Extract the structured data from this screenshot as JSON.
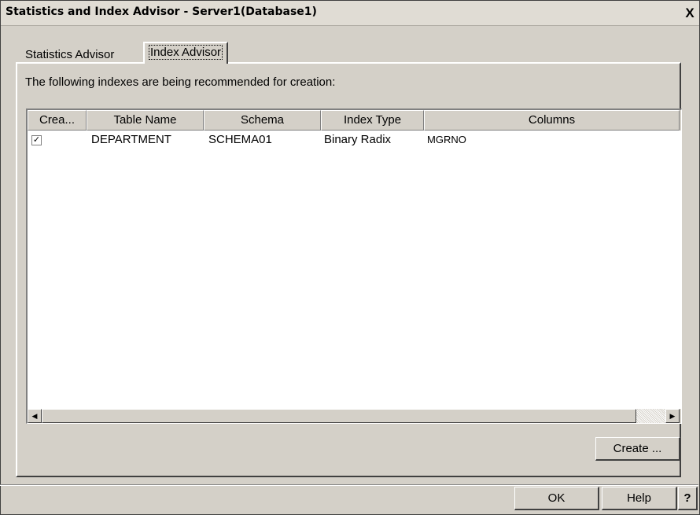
{
  "window": {
    "title": "Statistics and Index Advisor - Server1(Database1)",
    "close_label": "X"
  },
  "tabs": [
    {
      "label": "Statistics Advisor",
      "active": false
    },
    {
      "label": "Index Advisor",
      "active": true
    }
  ],
  "instruction": "The following indexes are being recommended for creation:",
  "table": {
    "columns": [
      "Crea...",
      "Table Name",
      "Schema",
      "Index Type",
      "Columns"
    ],
    "rows": [
      {
        "checked": true,
        "table_name": "DEPARTMENT",
        "schema": "SCHEMA01",
        "index_type": "Binary Radix",
        "columns": "MGRNO"
      }
    ]
  },
  "buttons": {
    "create": "Create ...",
    "ok": "OK",
    "help": "Help",
    "whats_this": "?"
  },
  "colors": {
    "dialog_bg": "#d4d0c8",
    "table_bg": "#ffffff"
  }
}
